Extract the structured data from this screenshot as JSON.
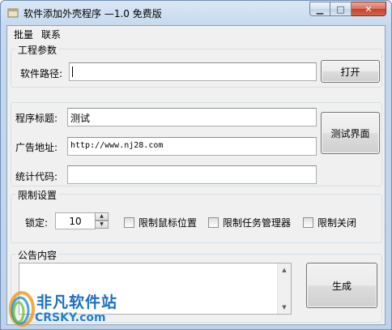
{
  "window": {
    "title": "软件添加外壳程序 —1.0 免费版",
    "minimize_glyph": "▁",
    "maximize_glyph": "□",
    "close_glyph": "✕"
  },
  "menu": {
    "items": [
      "批量",
      "联系"
    ]
  },
  "project_params": {
    "group_title": "工程参数",
    "path_label": "软件路径:",
    "path_value": "",
    "open_button": "打开"
  },
  "program": {
    "title_label": "程序标题:",
    "title_value": "测试",
    "ad_label": "广告地址:",
    "ad_value": "http://www.nj28.com",
    "stats_label": "统计代码:",
    "stats_value": "",
    "test_button": "测试界面"
  },
  "limits": {
    "group_title": "限制设置",
    "lock_label": "锁定:",
    "lock_value": "10",
    "spin_up": "▲",
    "spin_down": "▼",
    "checkboxes": [
      {
        "label": "限制鼠标位置",
        "checked": false
      },
      {
        "label": "限制任务管理器",
        "checked": false
      },
      {
        "label": "限制关闭",
        "checked": false
      }
    ]
  },
  "announcement": {
    "group_title": "公告内容",
    "content": "",
    "scroll_up": "▲",
    "scroll_down": "▼",
    "generate_button": "生成"
  },
  "watermark": {
    "text_cn": "非凡软件站",
    "text_en": "CRSKY.com"
  },
  "colors": {
    "title_bar": "#c6d9ee",
    "client_bg": "#f0f0f0",
    "close_button": "#c7432a",
    "watermark_blue": "#1a6fc0"
  }
}
